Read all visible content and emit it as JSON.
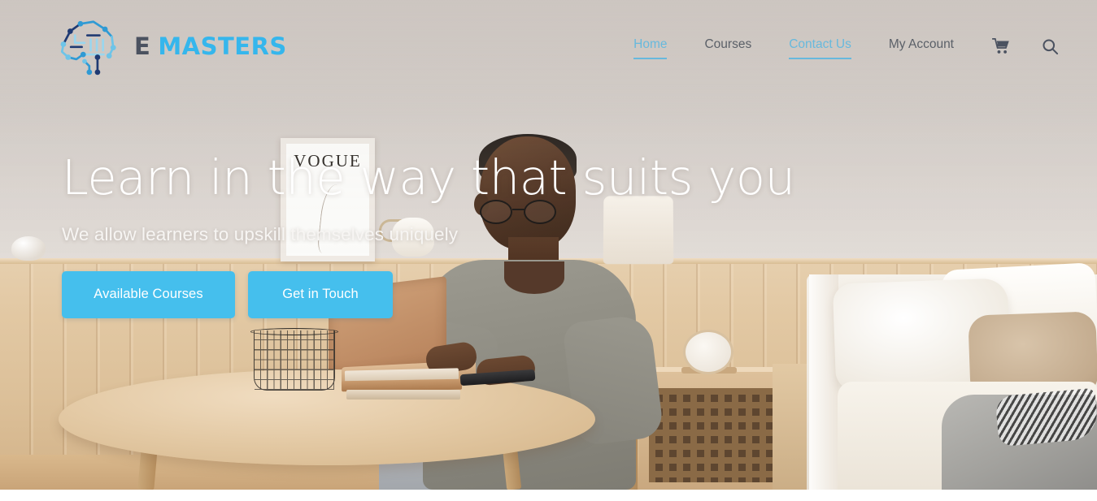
{
  "site": {
    "brand_e": "E",
    "brand_masters": "MASTERS",
    "logo_icon": "circuit-brain-logo-icon",
    "accent_color": "#45bfed",
    "nav_active_color": "#67b9dd",
    "header_bg": "#cdc6c1",
    "text_color": "#5b6068"
  },
  "nav": {
    "items": [
      {
        "label": "Home",
        "active": true
      },
      {
        "label": "Courses",
        "active": false
      },
      {
        "label": "Contact Us",
        "active": true
      },
      {
        "label": "My Account",
        "active": false
      }
    ],
    "cart_icon": "shopping-cart-icon",
    "search_icon": "search-icon"
  },
  "hero": {
    "title": "Learn in the way that suits you",
    "subtitle": "We allow learners to upskill themselves uniquely",
    "primary_button": "Available Courses",
    "secondary_button": "Get in Touch",
    "image_alt": "Young man with glasses studying on a laptop at a round wooden table in a bedroom"
  }
}
